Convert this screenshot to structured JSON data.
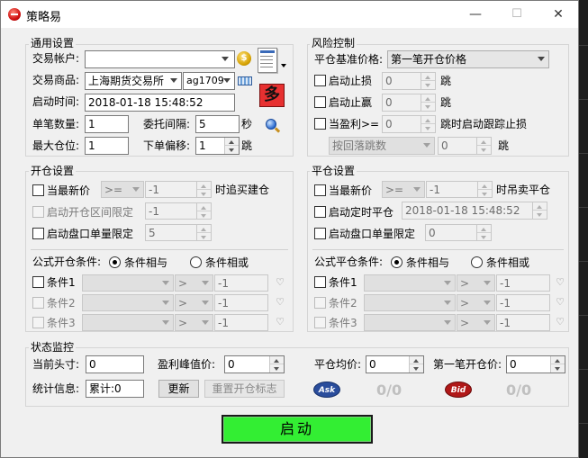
{
  "window": {
    "title": "策略易",
    "min": "—",
    "max": "☐",
    "close": "✕"
  },
  "general": {
    "title": "通用设置",
    "account_label": "交易帐户:",
    "account_value": "",
    "product_label": "交易商品:",
    "exchange": "上海期货交易所",
    "contract": "ag1709",
    "start_time_label": "启动时间:",
    "start_time": "2018-01-18 15:48:52",
    "lot_label": "单笔数量:",
    "lot": "1",
    "interval_label": "委托间隔:",
    "interval": "5",
    "interval_unit": "秒",
    "maxpos_label": "最大仓位:",
    "maxpos": "1",
    "offset_label": "下单偏移:",
    "offset": "1",
    "offset_unit": "跳",
    "duo": "多"
  },
  "risk": {
    "title": "风险控制",
    "benchmark_label": "平仓基准价格:",
    "benchmark": "第一笔开仓价格",
    "stoploss_label": "启动止损",
    "stoploss": "0",
    "stoploss_unit": "跳",
    "takeprofit_label": "启动止赢",
    "takeprofit": "0",
    "takeprofit_unit": "跳",
    "trail_label": "当盈利>=",
    "trail": "0",
    "trail_unit": "跳时启动跟踪止损",
    "pullback_mode": "按回落跳数",
    "pullback": "0",
    "pullback_unit": "跳"
  },
  "open": {
    "title": "开仓设置",
    "latest_label": "当最新价",
    "latest_op": ">=",
    "latest_val": "-1",
    "latest_action": "时追买建仓",
    "range_label": "启动开仓区间限定",
    "range_val": "-1",
    "book_label": "启动盘口单量限定",
    "book_val": "5",
    "formula_label": "公式开仓条件:",
    "and_label": "条件相与",
    "or_label": "条件相或",
    "cond1": "条件1",
    "cond2": "条件2",
    "cond3": "条件3",
    "cond_op": ">",
    "cond_val": "-1"
  },
  "close": {
    "title": "平仓设置",
    "latest_label": "当最新价",
    "latest_op": ">=",
    "latest_val": "-1",
    "latest_action": "时吊卖平仓",
    "timed_label": "启动定时平仓",
    "timed_val": "2018-01-18 15:48:52",
    "book_label": "启动盘口单量限定",
    "book_val": "0",
    "formula_label": "公式平仓条件:",
    "and_label": "条件相与",
    "or_label": "条件相或",
    "cond1": "条件1",
    "cond2": "条件2",
    "cond3": "条件3",
    "cond_op": ">",
    "cond_val": "-1"
  },
  "status": {
    "title": "状态监控",
    "position_label": "当前头寸:",
    "position": "0",
    "peak_label": "盈利峰值价:",
    "peak": "0",
    "avg_label": "平仓均价:",
    "avg": "0",
    "first_label": "第一笔开仓价:",
    "first": "0",
    "stats_label": "统计信息:",
    "stats": "累计:0",
    "update_btn": "更新",
    "reset_btn": "重置开仓标志",
    "ask": "Ask",
    "ask_ratio": "0/0",
    "bid": "Bid",
    "bid_ratio": "0/0"
  },
  "start_btn": "启动",
  "colors": {
    "start": "#33ee33",
    "ask": "#2a4d9c",
    "bid": "#b01818",
    "duo": "#e73030"
  }
}
